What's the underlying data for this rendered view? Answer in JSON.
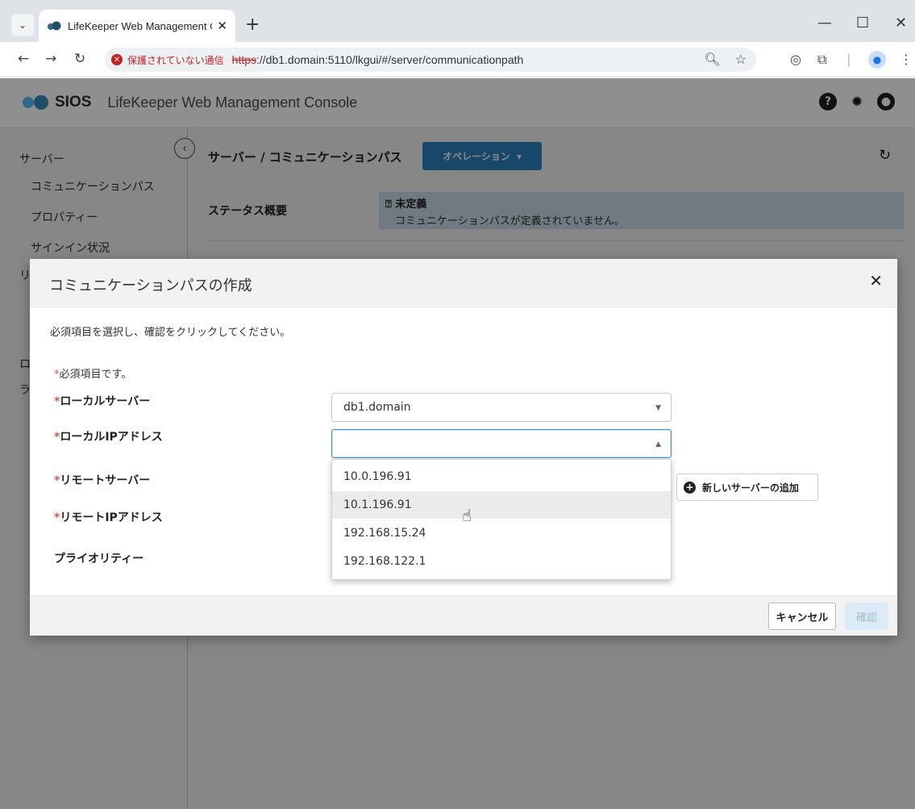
{
  "browser": {
    "tab_title": "LifeKeeper Web Management C",
    "security_warning": "保護されていない通信",
    "url_scheme": "https",
    "url_rest": "://db1.domain:5110/lkgui/#/server/communicationpath"
  },
  "header": {
    "brand": "SIOS",
    "product": "LifeKeeper Web Management Console",
    "icons": [
      "help-icon",
      "gear-icon",
      "user-icon"
    ]
  },
  "sidebar": {
    "heading": "サーバー",
    "items": [
      "コミュニケーションパス",
      "プロパティー",
      "サインイン状況"
    ],
    "cut_labels": [
      "リ",
      "ロ",
      "ラ"
    ]
  },
  "page": {
    "breadcrumb": "サーバー / コミュニケーションパス",
    "operation_button": "オペレーション",
    "status_label": "ステータス概要",
    "status_title": "未定義",
    "status_message": "コミュニケーションパスが定義されていません。"
  },
  "modal": {
    "title": "コミュニケーションパスの作成",
    "instruction": "必須項目を選択し、確認をクリックしてください。",
    "required_marker": "*",
    "required_note": "必須項目です。",
    "labels": {
      "local_server": "ローカルサーバー",
      "local_ip": "ローカルIPアドレス",
      "remote_server": "リモートサーバー",
      "remote_ip": "リモートIPアドレス",
      "priority": "プライオリティー"
    },
    "local_server_value": "db1.domain",
    "local_ip_value": "",
    "ip_options": [
      "10.0.196.91",
      "10.1.196.91",
      "192.168.15.24",
      "192.168.122.1"
    ],
    "hovered_option": "10.1.196.91",
    "add_server_button": "新しいサーバーの追加",
    "cancel_button": "キャンセル",
    "confirm_button": "確認"
  },
  "colors": {
    "primary": "#2d86c6",
    "status_bg": "#d2e7f3",
    "warning": "#c5221f",
    "required": "#d9534f"
  }
}
